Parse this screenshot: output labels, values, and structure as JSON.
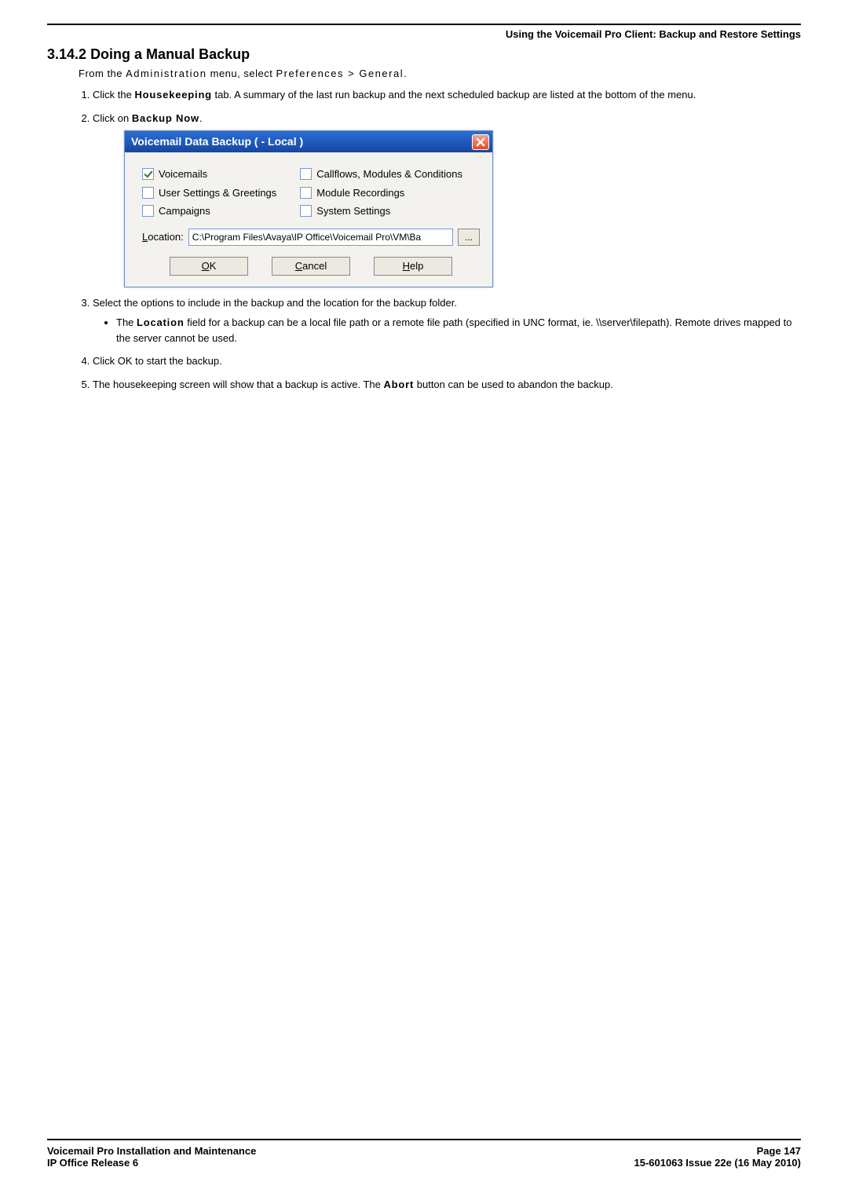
{
  "header": {
    "breadcrumb": "Using the Voicemail Pro Client: Backup and Restore Settings"
  },
  "section": {
    "number": "3.14.2",
    "title": "Doing a Manual Backup"
  },
  "intro": {
    "prefix": "From the ",
    "menu1": "Administration",
    "mid": " menu, select ",
    "menu2": "Preferences > General",
    "suffix": "."
  },
  "steps": {
    "s1_a": "Click the ",
    "s1_b": "Housekeeping",
    "s1_c": " tab. A summary of the last run backup and the next scheduled backup are listed at the bottom of the menu.",
    "s2_a": "Click on ",
    "s2_b": "Backup Now",
    "s2_c": ".",
    "s3": "Select the options to include in the backup and the location for the backup folder.",
    "s3_sub_a": "The ",
    "s3_sub_b": "Location",
    "s3_sub_c": " field for a backup can be a local file path or a remote file path (specified in UNC format, ie. \\\\server\\filepath). Remote drives mapped to the server cannot be used.",
    "s4": "Click OK to start the backup.",
    "s5_a": "The housekeeping screen will show that a backup is active. The ",
    "s5_b": "Abort",
    "s5_c": " button can be used to abandon the backup."
  },
  "dialog": {
    "title": "Voicemail Data Backup (  - Local )",
    "options": {
      "voicemails": {
        "label": "Voicemails",
        "checked": true
      },
      "user_settings": {
        "label": "User Settings & Greetings",
        "checked": false
      },
      "campaigns": {
        "label": "Campaigns",
        "checked": false
      },
      "callflows": {
        "label": "Callflows, Modules & Conditions",
        "checked": false
      },
      "module_recordings": {
        "label": "Module Recordings",
        "checked": false
      },
      "system_settings": {
        "label": "System Settings",
        "checked": false
      }
    },
    "location_label": "Location:",
    "location_value": "C:\\Program Files\\Avaya\\IP Office\\Voicemail Pro\\VM\\Ba",
    "browse_label": "...",
    "buttons": {
      "ok": {
        "mnemonic": "O",
        "rest": "K"
      },
      "cancel": {
        "mnemonic": "C",
        "rest": "ancel"
      },
      "help": {
        "mnemonic": "H",
        "rest": "elp"
      }
    }
  },
  "footer": {
    "left1": "Voicemail Pro Installation and Maintenance",
    "left2": "IP Office Release 6",
    "right1": "Page 147",
    "right2": "15-601063 Issue 22e (16 May 2010)"
  }
}
